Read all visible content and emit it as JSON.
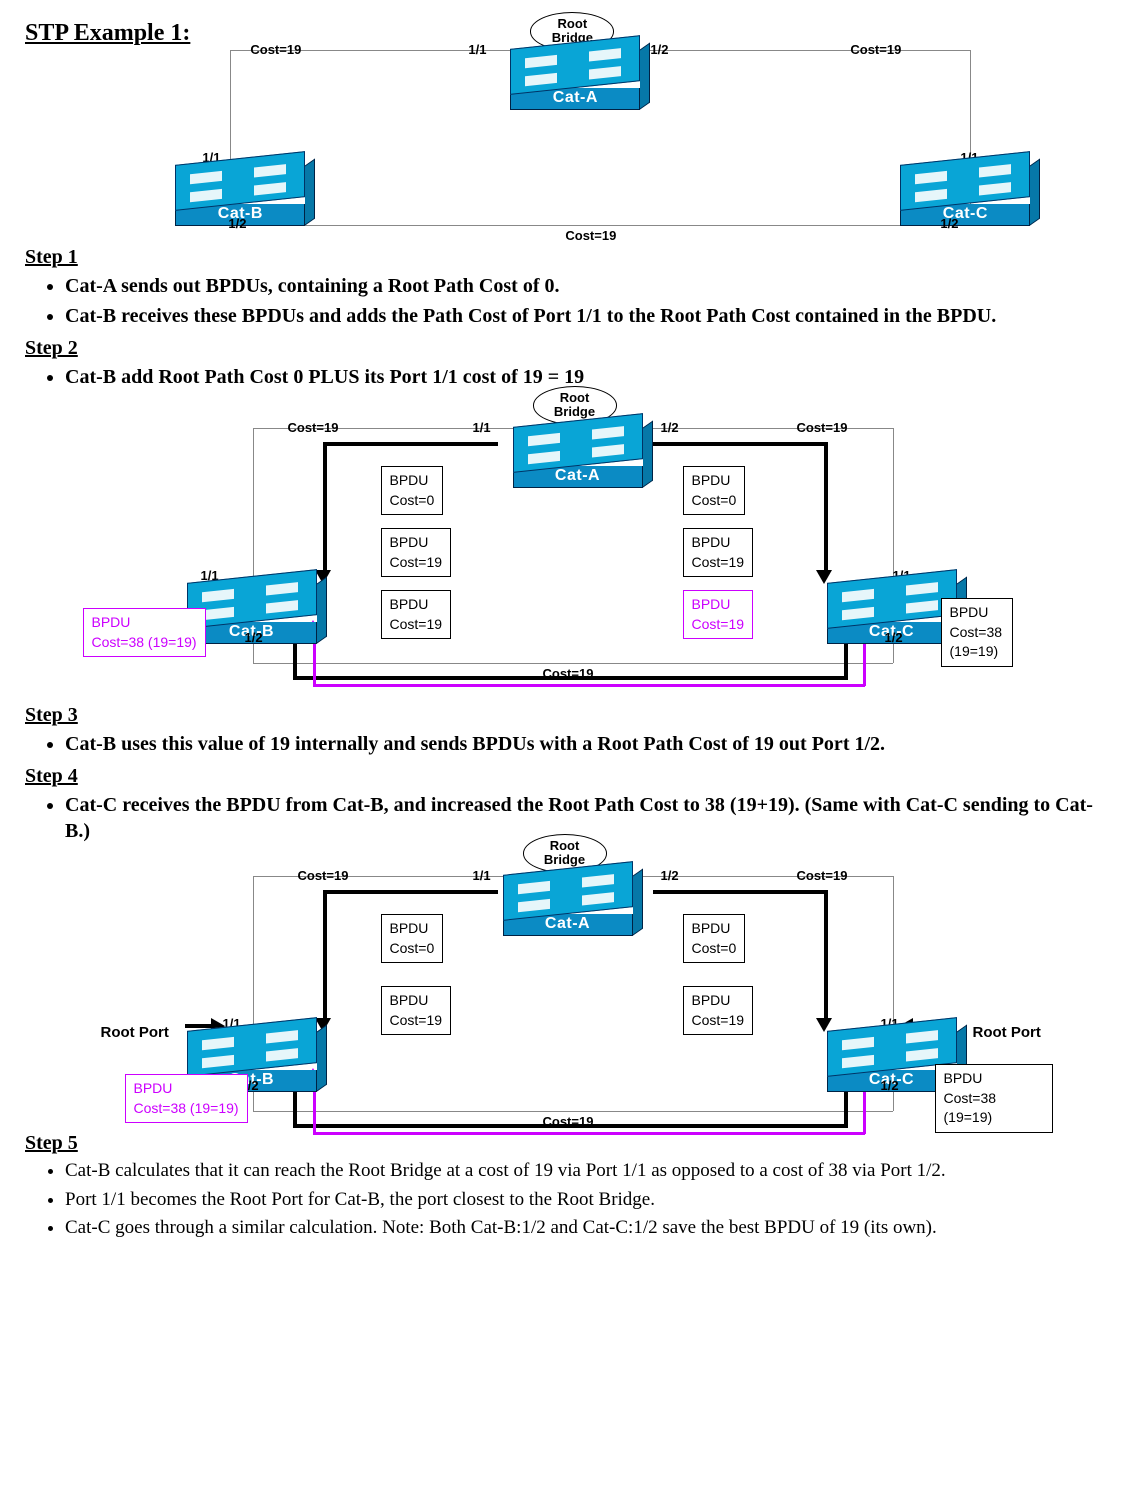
{
  "title": "STP Example 1:",
  "switches": {
    "a": "Cat-A",
    "b": "Cat-B",
    "c": "Cat-C"
  },
  "ports": {
    "p1": "1/1",
    "p2": "1/2"
  },
  "labels": {
    "cost19": "Cost=19",
    "root_bridge": "Root\nBridge",
    "root_port": "Root Port"
  },
  "bpdu": {
    "name": "BPDU",
    "cost0": "Cost=0",
    "cost19": "Cost=19",
    "cost38": "Cost=38 (19=19)"
  },
  "steps": {
    "s1": {
      "head": "Step 1",
      "items": [
        "Cat-A sends out BPDUs, containing a Root Path Cost of 0.",
        "Cat-B receives these BPDUs and adds the Path Cost of Port 1/1 to the Root Path Cost contained in the BPDU."
      ]
    },
    "s2": {
      "head": "Step 2",
      "items": [
        "Cat-B add Root Path Cost 0 PLUS its Port 1/1 cost of 19 = 19"
      ]
    },
    "s3": {
      "head": "Step 3",
      "items": [
        "Cat-B uses this value of 19 internally and sends BPDUs with a Root Path Cost of 19 out Port 1/2."
      ]
    },
    "s4": {
      "head": "Step 4",
      "items": [
        "Cat-C receives the BPDU from Cat-B, and increased the Root Path Cost to 38 (19+19). (Same with Cat-C sending to Cat-B.)"
      ]
    },
    "s5": {
      "head": "Step 5",
      "items": [
        "Cat-B calculates that it can reach the Root Bridge at a cost of 19 via Port 1/1 as opposed to a cost of 38 via Port 1/2.",
        "Port 1/1 becomes the Root Port for Cat-B, the port closest to the Root Bridge.",
        "Cat-C goes through a similar calculation. Note: Both Cat-B:1/2 and Cat-C:1/2 save the best BPDU of 19 (its own)."
      ]
    }
  }
}
